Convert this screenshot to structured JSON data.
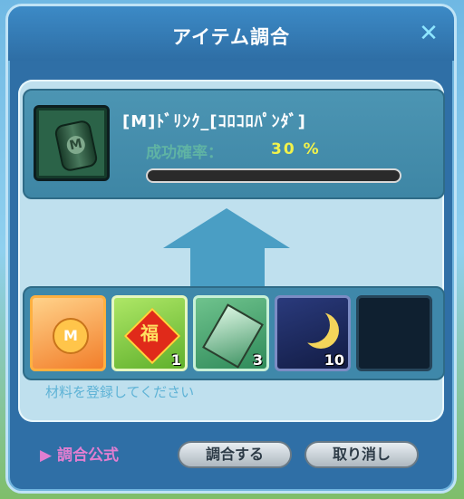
{
  "window": {
    "title": "アイテム調合",
    "close_glyph": "✕"
  },
  "result": {
    "item_name": "[M]ﾄﾞﾘﾝｸ_[ｺﾛｺﾛﾊﾟﾝﾀﾞ]",
    "can_letter": "M",
    "success_label": "成功確率：",
    "success_value": "30 %",
    "progress_fraction": 0
  },
  "materials": [
    {
      "icon": "candy-icon",
      "glyph": "M",
      "count": ""
    },
    {
      "icon": "fuku-charm-icon",
      "glyph": "福",
      "count": "1"
    },
    {
      "icon": "card-icon",
      "glyph": "",
      "count": "3"
    },
    {
      "icon": "moon-icon",
      "glyph": "",
      "count": "10"
    },
    {
      "icon": "empty-slot",
      "glyph": "",
      "count": ""
    }
  ],
  "hint_text": "材料を登録してください",
  "footer": {
    "formula_label": "▶ 調合公式",
    "combine_button": "調合する",
    "cancel_button": "取り消し"
  },
  "colors": {
    "window_bg": "#2f6fa6",
    "rate_value": "#f2f24a",
    "formula_link": "#e27ed1"
  }
}
